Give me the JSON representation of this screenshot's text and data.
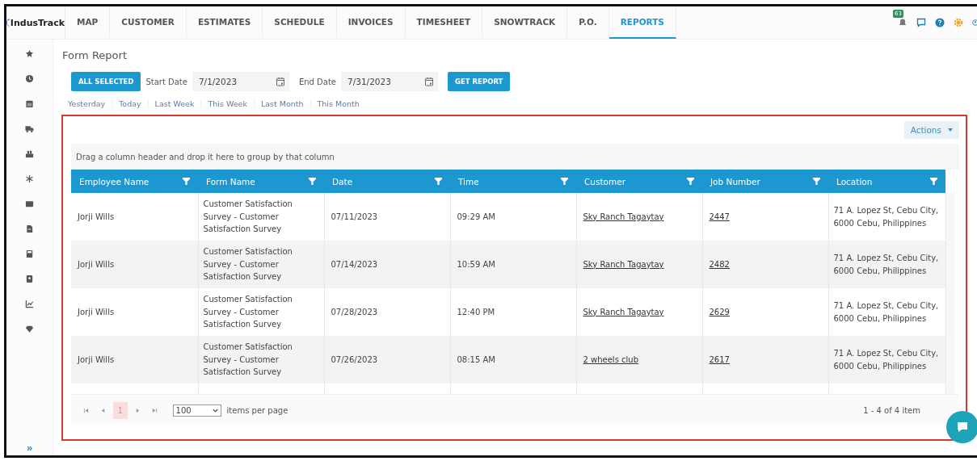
{
  "logo": "IndusTrack",
  "nav": [
    {
      "label": "MAP",
      "selected": false
    },
    {
      "label": "CUSTOMER",
      "selected": false
    },
    {
      "label": "ESTIMATES",
      "selected": false
    },
    {
      "label": "SCHEDULE",
      "selected": false
    },
    {
      "label": "INVOICES",
      "selected": false
    },
    {
      "label": "TIMESHEET",
      "selected": false
    },
    {
      "label": "SNOWTRACK",
      "selected": false
    },
    {
      "label": "P.O.",
      "selected": false
    },
    {
      "label": "REPORTS",
      "selected": true
    }
  ],
  "notification_badge": "63",
  "sidebar": {
    "expand": "»"
  },
  "page_title": "Form Report",
  "all_selected": "ALL SELECTED",
  "start_date": {
    "label": "Start Date",
    "value": "7/1/2023"
  },
  "end_date": {
    "label": "End Date",
    "value": "7/31/2023"
  },
  "get_report": "GET REPORT",
  "quick_ranges": [
    "Yesterday",
    "Today",
    "Last Week",
    "This Week",
    "Last Month",
    "This Month"
  ],
  "actions": "Actions",
  "group_hint": "Drag a column header and drop it here to group by that column",
  "table": {
    "columns": [
      "Employee Name",
      "Form Name",
      "Date",
      "Time",
      "Customer",
      "Job Number",
      "Location"
    ],
    "rows": [
      {
        "employee": "Jorji Wills",
        "form": "Customer Satisfaction Survey - Customer Satisfaction Survey",
        "date": "07/11/2023",
        "time": "09:29 AM",
        "customer": "Sky Ranch Tagaytay",
        "job": "2447",
        "location": "71 A. Lopez St, Cebu City, 6000 Cebu, Philippines"
      },
      {
        "employee": "Jorji Wills",
        "form": "Customer Satisfaction Survey - Customer Satisfaction Survey",
        "date": "07/14/2023",
        "time": "10:59 AM",
        "customer": "Sky Ranch Tagaytay",
        "job": "2482",
        "location": "71 A. Lopez St, Cebu City, 6000 Cebu, Philippines"
      },
      {
        "employee": "Jorji Wills",
        "form": "Customer Satisfaction Survey - Customer Satisfaction Survey",
        "date": "07/28/2023",
        "time": "12:40 PM",
        "customer": "Sky Ranch Tagaytay",
        "job": "2629",
        "location": "71 A. Lopez St, Cebu City, 6000 Cebu, Philippines"
      },
      {
        "employee": "Jorji Wills",
        "form": "Customer Satisfaction Survey - Customer Satisfaction Survey",
        "date": "07/26/2023",
        "time": "08:15 AM",
        "customer": "2 wheels club",
        "job": "2617",
        "location": "71 A. Lopez St, Cebu City, 6000 Cebu, Philippines"
      }
    ]
  },
  "pager": {
    "pages": [
      {
        "label": "1",
        "selected": true
      }
    ],
    "page_size": "100",
    "page_size_label": "items per page",
    "summary": "1 - 4 of 4 item"
  }
}
